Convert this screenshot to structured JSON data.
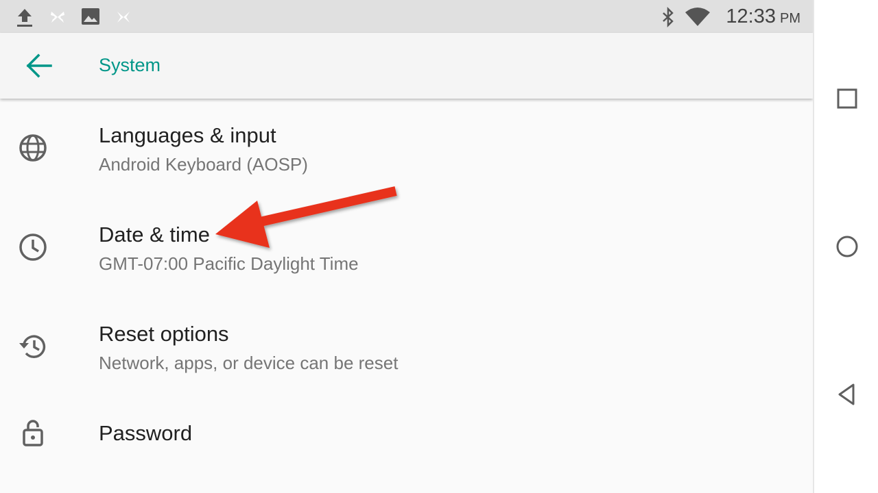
{
  "status_bar": {
    "time": "12:33",
    "ampm": "PM",
    "left_icons": [
      "upload-icon",
      "pinwheel-icon",
      "image-icon",
      "pinwheel-icon"
    ],
    "right_icons": [
      "bluetooth-icon",
      "wifi-icon"
    ]
  },
  "toolbar": {
    "title": "System",
    "back_icon": "arrow-left-icon"
  },
  "settings": {
    "items": [
      {
        "title": "Languages & input",
        "subtitle": "Android Keyboard (AOSP)",
        "icon": "globe-icon"
      },
      {
        "title": "Date & time",
        "subtitle": "GMT-07:00 Pacific Daylight Time",
        "icon": "clock-icon"
      },
      {
        "title": "Reset options",
        "subtitle": "Network, apps, or device can be reset",
        "icon": "history-icon"
      },
      {
        "title": "Password",
        "subtitle": "",
        "icon": "lock-open-icon"
      }
    ]
  },
  "nav_bar": {
    "buttons": [
      "recents-icon",
      "home-icon",
      "back-icon"
    ]
  },
  "colors": {
    "accent": "#009688",
    "annotation_arrow": "#e8301a",
    "status_bar_bg": "#e0e0e0",
    "toolbar_bg": "#f5f5f5",
    "background": "#fafafa"
  }
}
